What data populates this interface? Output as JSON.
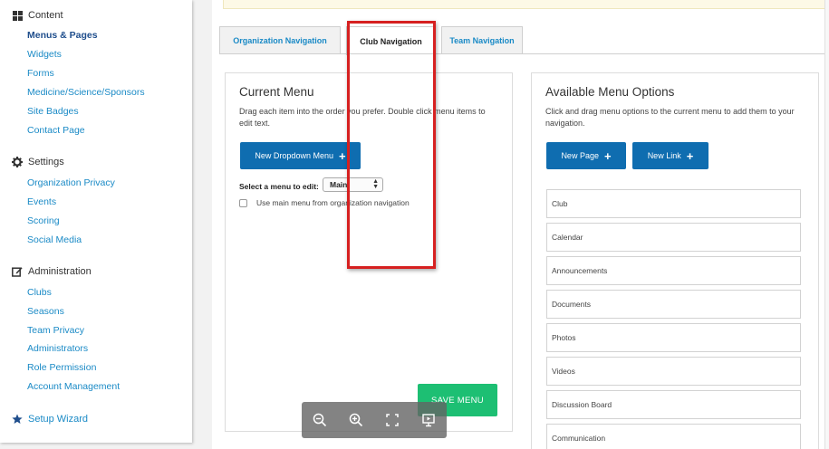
{
  "sidebar": {
    "content": {
      "title": "Content",
      "icon": "grid-icon",
      "items": [
        "Menus & Pages",
        "Widgets",
        "Forms",
        "Medicine/Science/Sponsors",
        "Site Badges",
        "Contact Page"
      ]
    },
    "settings": {
      "title": "Settings",
      "icon": "gear-icon",
      "items": [
        "Organization Privacy",
        "Events",
        "Scoring",
        "Social Media"
      ]
    },
    "administration": {
      "title": "Administration",
      "icon": "edit-icon",
      "items": [
        "Clubs",
        "Seasons",
        "Team Privacy",
        "Administrators",
        "Role Permission",
        "Account Management"
      ]
    },
    "setup_wizard": "Setup Wizard"
  },
  "tabs": [
    "Organization Navigation",
    "Club Navigation",
    "Team Navigation"
  ],
  "current_menu": {
    "title": "Current Menu",
    "description": "Drag each item into the order you prefer. Double click menu items to edit text.",
    "new_dropdown_label": "New Dropdown Menu",
    "select_label": "Select a menu to edit:",
    "select_value": "Main",
    "checkbox_label": "Use main menu from organization navigation",
    "save_label": "SAVE MENU"
  },
  "available": {
    "title": "Available Menu Options",
    "description": "Click and drag menu options to the current menu to add them to your navigation.",
    "new_page_label": "New Page",
    "new_link_label": "New Link",
    "options": [
      "Club",
      "Calendar",
      "Announcements",
      "Documents",
      "Photos",
      "Videos",
      "Discussion Board",
      "Communication"
    ]
  },
  "colors": {
    "link": "#1a8ac6",
    "primary_button": "#0f6db0",
    "save_button": "#1dbf73",
    "highlight": "#d62020"
  }
}
